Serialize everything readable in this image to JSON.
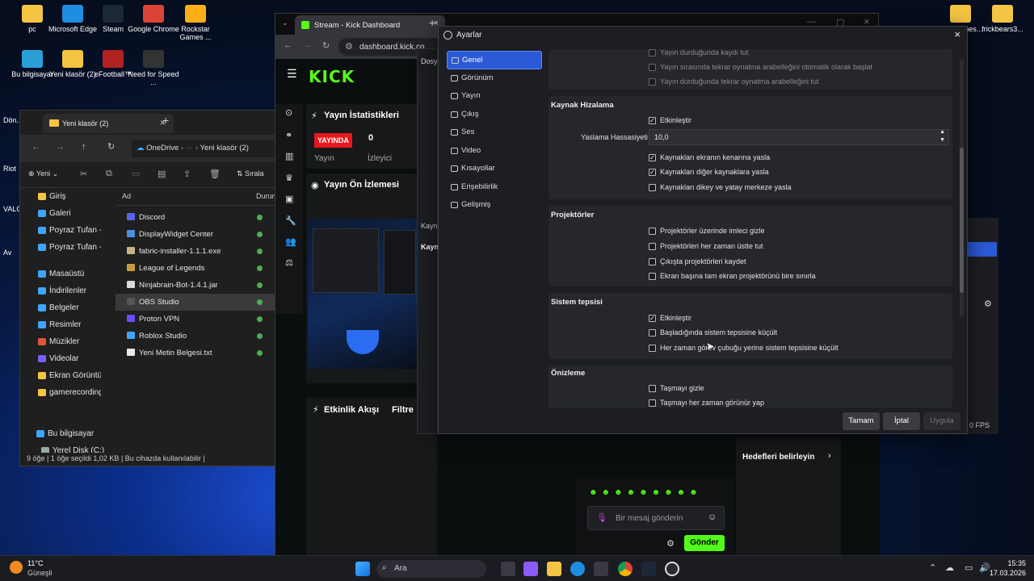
{
  "desktop": {
    "icons_left": [
      {
        "label": "pc",
        "color": "#f4c542"
      },
      {
        "label": "Microsoft Edge",
        "color": "#1f8de0"
      },
      {
        "label": "Steam",
        "color": "#1b2838"
      },
      {
        "label": "Google Chrome",
        "color": "#db4437"
      },
      {
        "label": "Rockstar Games ...",
        "color": "#fcaf17"
      },
      {
        "label": "Bu bilgisayar",
        "color": "#2aa0d8"
      },
      {
        "label": "Yeni klasör (2)",
        "color": "#f4c542"
      },
      {
        "label": "eFootball™",
        "color": "#b22222"
      },
      {
        "label": "Need for Speed ...",
        "color": "#333333"
      }
    ],
    "icons_right": [
      {
        "label": "Ace Games...",
        "color": "#f4c542"
      },
      {
        "label": "frickbears3...",
        "color": "#f4c542"
      }
    ],
    "edge_labels": [
      "Dön...",
      "Riot",
      "VALO",
      "Av"
    ]
  },
  "explorer": {
    "tab_title": "Yeni klasör (2)",
    "breadcrumb": [
      "OneDrive",
      "Yeni klasör (2)"
    ],
    "toolbar": {
      "new_label": "Yeni",
      "sort_label": "Sırala"
    },
    "columns": {
      "name": "Ad",
      "status": "Durum"
    },
    "files": [
      {
        "name": "Discord",
        "color": "#5865f2"
      },
      {
        "name": "DisplayWidget Center",
        "color": "#4a90e2"
      },
      {
        "name": "fabric-installer-1.1.1.exe",
        "color": "#c8b28a"
      },
      {
        "name": "League of Legends",
        "color": "#c89b3c"
      },
      {
        "name": "Ninjabrain-Bot-1.4.1.jar",
        "color": "#d9d9d9"
      },
      {
        "name": "OBS Studio",
        "color": "#555555"
      },
      {
        "name": "Proton VPN",
        "color": "#6d4aff"
      },
      {
        "name": "Roblox Studio",
        "color": "#3ea6ff"
      },
      {
        "name": "Yeni Metin Belgesi.txt",
        "color": "#e8e8e8"
      }
    ],
    "sidebar": [
      {
        "label": "Giriş",
        "color": "#f4c542"
      },
      {
        "label": "Galeri",
        "color": "#3ea6ff"
      },
      {
        "label": "Poyraz Tufan - K",
        "color": "#3ea6ff"
      },
      {
        "label": "Poyraz Tufan - K",
        "color": "#3ea6ff"
      },
      {
        "label": "Masaüstü",
        "color": "#3ea6ff"
      },
      {
        "label": "İndirilenler",
        "color": "#3ea6ff"
      },
      {
        "label": "Belgeler",
        "color": "#3ea6ff"
      },
      {
        "label": "Resimler",
        "color": "#3ea6ff"
      },
      {
        "label": "Müzikler",
        "color": "#e0533d"
      },
      {
        "label": "Videolar",
        "color": "#7a5cff"
      },
      {
        "label": "Ekran Görüntüle",
        "color": "#f4c542"
      },
      {
        "label": "gamerecordings",
        "color": "#f4c542"
      }
    ],
    "this_pc": "Bu bilgisayar",
    "local_disk": "Yerel Disk (C:)",
    "status": {
      "items": "9 öğe",
      "selected": "1 öğe seçildi  1,02 KB",
      "availability": "Bu cihazda kullanılabilir"
    }
  },
  "browser": {
    "tab_title": "Stream - Kick Dashboard",
    "url": "dashboard.kick.co",
    "kick": {
      "logo": "KICK",
      "stats_title": "Yayın İstatistikleri",
      "live_badge": "YAYINDA",
      "viewers_value": "0",
      "stream_label": "Yayın",
      "viewers_label": "İzleyici",
      "preview_title": "Yayın Ön İzlemesi",
      "activity_title": "Etkinlik Akışı",
      "filter_label": "Filtre",
      "goals_label": "Hedefleri belirleyin",
      "chat_placeholder": "Bir mesaj gönderin",
      "send_label": "Gönder",
      "fps": "0 FPS"
    },
    "behind_obs": {
      "file_menu": "Dosya",
      "source1": "Kayna",
      "source2": "Kayn"
    }
  },
  "obs": {
    "title": "Ayarlar",
    "nav": [
      {
        "label": "Genel",
        "active": true
      },
      {
        "label": "Görünüm",
        "active": false
      },
      {
        "label": "Yayın",
        "active": false
      },
      {
        "label": "Çıkış",
        "active": false
      },
      {
        "label": "Ses",
        "active": false
      },
      {
        "label": "Video",
        "active": false
      },
      {
        "label": "Kısayollar",
        "active": false
      },
      {
        "label": "Erişebilirlik",
        "active": false
      },
      {
        "label": "Gelişmiş",
        "active": false
      }
    ],
    "replay": {
      "stop_record": "Yayın durduğunda kaydı tut",
      "replay_while": "Yayın sırasında tekrar oynatma arabelleğini otomatik olarak başlat",
      "replay_stop": "Yayın durduğunda tekrar oynatma arabelleğini tut"
    },
    "snapping": {
      "title": "Kaynak Hizalama",
      "enable": "Etkinleştir",
      "sensitivity_label": "Yaslama Hassasiyeti",
      "sensitivity_value": "10,0",
      "screen_edge": "Kaynakları ekranın kenarına yasla",
      "other_sources": "Kaynakları diğer kaynaklara yasla",
      "center": "Kaynakları dikey ve yatay merkeze yasla"
    },
    "projectors": {
      "title": "Projektörler",
      "hide_cursor": "Projektörler üzerinde imleci gizle",
      "always_top": "Projektörleri her zaman üstte tut",
      "save_exit": "Çıkışta projektörleri kaydet",
      "limit_one": "Ekran başına tam ekran projektörünü bire sınırla"
    },
    "tray": {
      "title": "Sistem tepsisi",
      "enable": "Etkinleştir",
      "minimize_start": "Başladığında sistem tepsisine küçült",
      "always_minimize": "Her zaman görev çubuğu yerine sistem tepsisine küçült"
    },
    "preview": {
      "title": "Önizleme",
      "hide_overflow": "Taşmayı gizle",
      "overflow_visible": "Taşmayı her zaman görünür yap"
    },
    "buttons": {
      "ok": "Tamam",
      "cancel": "İptal",
      "apply": "Uygula"
    }
  },
  "taskbar": {
    "weather_temp": "11°C",
    "weather_text": "Güneşli",
    "search_label": "Ara",
    "time": "15:35",
    "date": "17.03.2026"
  }
}
